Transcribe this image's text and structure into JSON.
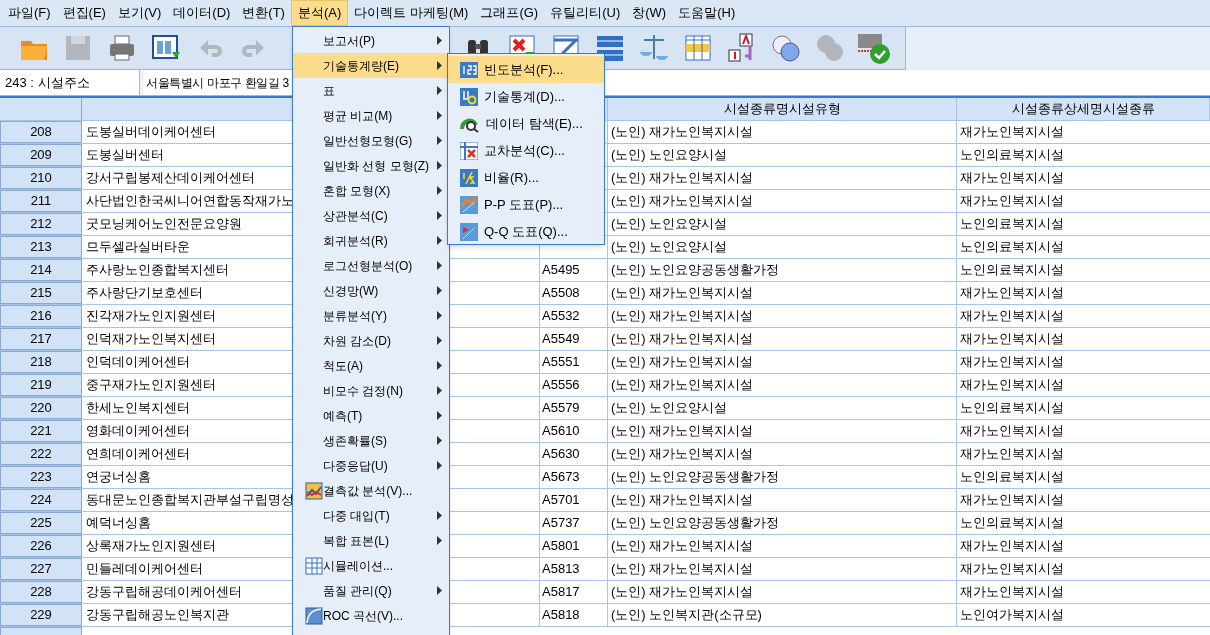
{
  "menu_bar": [
    {
      "label": "파일(F)",
      "selected": false
    },
    {
      "label": "편집(E)",
      "selected": false
    },
    {
      "label": "보기(V)",
      "selected": false
    },
    {
      "label": "데이터(D)",
      "selected": false
    },
    {
      "label": "변환(T)",
      "selected": false
    },
    {
      "label": "분석(A)",
      "selected": true
    },
    {
      "label": "다이렉트 마케팅(M)",
      "selected": false
    },
    {
      "label": "그래프(G)",
      "selected": false
    },
    {
      "label": "유틸리티(U)",
      "selected": false
    },
    {
      "label": "창(W)",
      "selected": false
    },
    {
      "label": "도움말(H)",
      "selected": false
    }
  ],
  "toolbar": [
    {
      "kind": "open",
      "disabled": false
    },
    {
      "kind": "save",
      "disabled": true
    },
    {
      "kind": "print",
      "disabled": false
    },
    {
      "kind": "recall",
      "disabled": false
    },
    {
      "kind": "undo",
      "disabled": true
    },
    {
      "kind": "redo",
      "disabled": true
    },
    {
      "kind": "gap"
    },
    {
      "kind": "find",
      "disabled": false
    },
    {
      "kind": "insert-cases",
      "disabled": false
    },
    {
      "kind": "insert-variable",
      "disabled": false
    },
    {
      "kind": "split",
      "disabled": false
    },
    {
      "kind": "weight",
      "disabled": false
    },
    {
      "kind": "select-cases",
      "disabled": false
    },
    {
      "kind": "value-labels",
      "disabled": false
    },
    {
      "kind": "sets",
      "disabled": false
    },
    {
      "kind": "show-all",
      "disabled": true
    },
    {
      "kind": "spell",
      "disabled": false
    }
  ],
  "cell_editor": {
    "cell": "243 : 시설주소",
    "value": "서울특별시 마포구 환일길 3"
  },
  "table": {
    "columns": [
      "시설종류명시설유형",
      "시설종류상세명시설종류"
    ],
    "rows": [
      {
        "num": "208",
        "name": "도봉실버데이케어센터",
        "type": "(노인) 재가노인복지시설",
        "detail": "재가노인복지시설"
      },
      {
        "num": "209",
        "name": "도봉실버센터",
        "type": "(노인) 노인요양시설",
        "detail": "노인의료복지시설"
      },
      {
        "num": "210",
        "name": "강서구립봉제산데이케어센터",
        "type": "(노인) 재가노인복지시설",
        "detail": "재가노인복지시설"
      },
      {
        "num": "211",
        "name": "사단법인한국씨니어연합동작재가노",
        "type": "(노인) 재가노인복지시설",
        "detail": "재가노인복지시설"
      },
      {
        "num": "212",
        "name": "굿모닝케어노인전문요양원",
        "type": "(노인) 노인요양시설",
        "detail": "노인의료복지시설"
      },
      {
        "num": "213",
        "name": "므두셀라실버타운",
        "type": "(노인) 노인요양시설",
        "detail": "노인의료복지시설"
      },
      {
        "num": "214",
        "name": "주사랑노인종합복지센터",
        "code": "A5495",
        "type": "(노인) 노인요양공동생활가정",
        "detail": "노인의료복지시설"
      },
      {
        "num": "215",
        "name": "주사랑단기보호센터",
        "code": "A5508",
        "type": "(노인) 재가노인복지시설",
        "detail": "재가노인복지시설"
      },
      {
        "num": "216",
        "name": "진각재가노인지원센터",
        "code": "A5532",
        "type": "(노인) 재가노인복지시설",
        "detail": "재가노인복지시설"
      },
      {
        "num": "217",
        "name": "인덕재가노인복지센터",
        "code": "A5549",
        "type": "(노인) 재가노인복지시설",
        "detail": "재가노인복지시설"
      },
      {
        "num": "218",
        "name": "인덕데이케어센터",
        "code": "A5551",
        "type": "(노인) 재가노인복지시설",
        "detail": "재가노인복지시설"
      },
      {
        "num": "219",
        "name": "중구재가노인지원센터",
        "code": "A5556",
        "type": "(노인) 재가노인복지시설",
        "detail": "재가노인복지시설"
      },
      {
        "num": "220",
        "name": "한세노인복지센터",
        "code": "A5579",
        "type": "(노인) 노인요양시설",
        "detail": "노인의료복지시설"
      },
      {
        "num": "221",
        "name": "영화데이케어센터",
        "code": "A5610",
        "type": "(노인) 재가노인복지시설",
        "detail": "재가노인복지시설"
      },
      {
        "num": "222",
        "name": "연희데이케어센터",
        "code": "A5630",
        "type": "(노인) 재가노인복지시설",
        "detail": "재가노인복지시설"
      },
      {
        "num": "223",
        "name": "연궁너싱홈",
        "code": "A5673",
        "type": "(노인) 노인요양공동생활가정",
        "detail": "노인의료복지시설"
      },
      {
        "num": "224",
        "name": "동대문노인종합복지관부설구립명성",
        "code": "A5701",
        "type": "(노인) 재가노인복지시설",
        "detail": "재가노인복지시설"
      },
      {
        "num": "225",
        "name": "예덕너싱홈",
        "code": "A5737",
        "type": "(노인) 노인요양공동생활가정",
        "detail": "노인의료복지시설"
      },
      {
        "num": "226",
        "name": "상록재가노인지원센터",
        "code": "A5801",
        "type": "(노인) 재가노인복지시설",
        "detail": "재가노인복지시설"
      },
      {
        "num": "227",
        "name": "민들레데이케어센터",
        "code": "A5813",
        "type": "(노인) 재가노인복지시설",
        "detail": "재가노인복지시설"
      },
      {
        "num": "228",
        "name": "강동구립해공데이케어센터",
        "code": "A5817",
        "type": "(노인) 재가노인복지시설",
        "detail": "재가노인복지시설"
      },
      {
        "num": "229",
        "name": "강동구립해공노인복지관",
        "code": "A5818",
        "type": "(노인) 노인복지관(소규모)",
        "detail": "노인여가복지시설"
      }
    ]
  },
  "analyze_menu": [
    {
      "label": "보고서(P)",
      "kind": "submenu",
      "selected": false
    },
    {
      "label": "기술통계량(E)",
      "kind": "submenu",
      "selected": true
    },
    {
      "label": "표",
      "kind": "submenu",
      "selected": false
    },
    {
      "label": "평균 비교(M)",
      "kind": "submenu",
      "selected": false
    },
    {
      "label": "일반선형모형(G)",
      "kind": "submenu",
      "selected": false
    },
    {
      "label": "일반화 선형 모형(Z)",
      "kind": "submenu",
      "selected": false
    },
    {
      "label": "혼합 모형(X)",
      "kind": "submenu",
      "selected": false
    },
    {
      "label": "상관분석(C)",
      "kind": "submenu",
      "selected": false
    },
    {
      "label": "회귀분석(R)",
      "kind": "submenu",
      "selected": false
    },
    {
      "label": "로그선형분석(O)",
      "kind": "submenu",
      "selected": false
    },
    {
      "label": "신경망(W)",
      "kind": "submenu",
      "selected": false
    },
    {
      "label": "분류분석(Y)",
      "kind": "submenu",
      "selected": false
    },
    {
      "label": "차원 감소(D)",
      "kind": "submenu",
      "selected": false
    },
    {
      "label": "척도(A)",
      "kind": "submenu",
      "selected": false
    },
    {
      "label": "비모수 검정(N)",
      "kind": "submenu",
      "selected": false
    },
    {
      "label": "예측(T)",
      "kind": "submenu",
      "selected": false
    },
    {
      "label": "생존확률(S)",
      "kind": "submenu",
      "selected": false
    },
    {
      "label": "다중응답(U)",
      "kind": "submenu",
      "selected": false
    },
    {
      "label": "결측값 분석(V)...",
      "kind": "missing",
      "selected": false
    },
    {
      "label": "다중 대입(T)",
      "kind": "submenu",
      "selected": false
    },
    {
      "label": "복합 표본(L)",
      "kind": "submenu",
      "selected": false
    },
    {
      "label": "시뮬레이션...",
      "kind": "simulation",
      "selected": false
    },
    {
      "label": "품질 관리(Q)",
      "kind": "submenu",
      "selected": false
    },
    {
      "label": "ROC 곡선(V)...",
      "kind": "roc",
      "selected": false
    }
  ],
  "descriptives_submenu": [
    {
      "label": "빈도분석(F)...",
      "kind": "frequencies",
      "selected": true
    },
    {
      "label": "기술통계(D)...",
      "kind": "descriptives",
      "selected": false
    },
    {
      "label": "데이터 탐색(E)...",
      "kind": "explore",
      "selected": false
    },
    {
      "label": "교차분석(C)...",
      "kind": "crosstabs",
      "selected": false
    },
    {
      "label": "비율(R)...",
      "kind": "ratio",
      "selected": false
    },
    {
      "label": "P-P 도표(P)...",
      "kind": "pp",
      "selected": false
    },
    {
      "label": "Q-Q 도표(Q)...",
      "kind": "qq",
      "selected": false
    }
  ]
}
